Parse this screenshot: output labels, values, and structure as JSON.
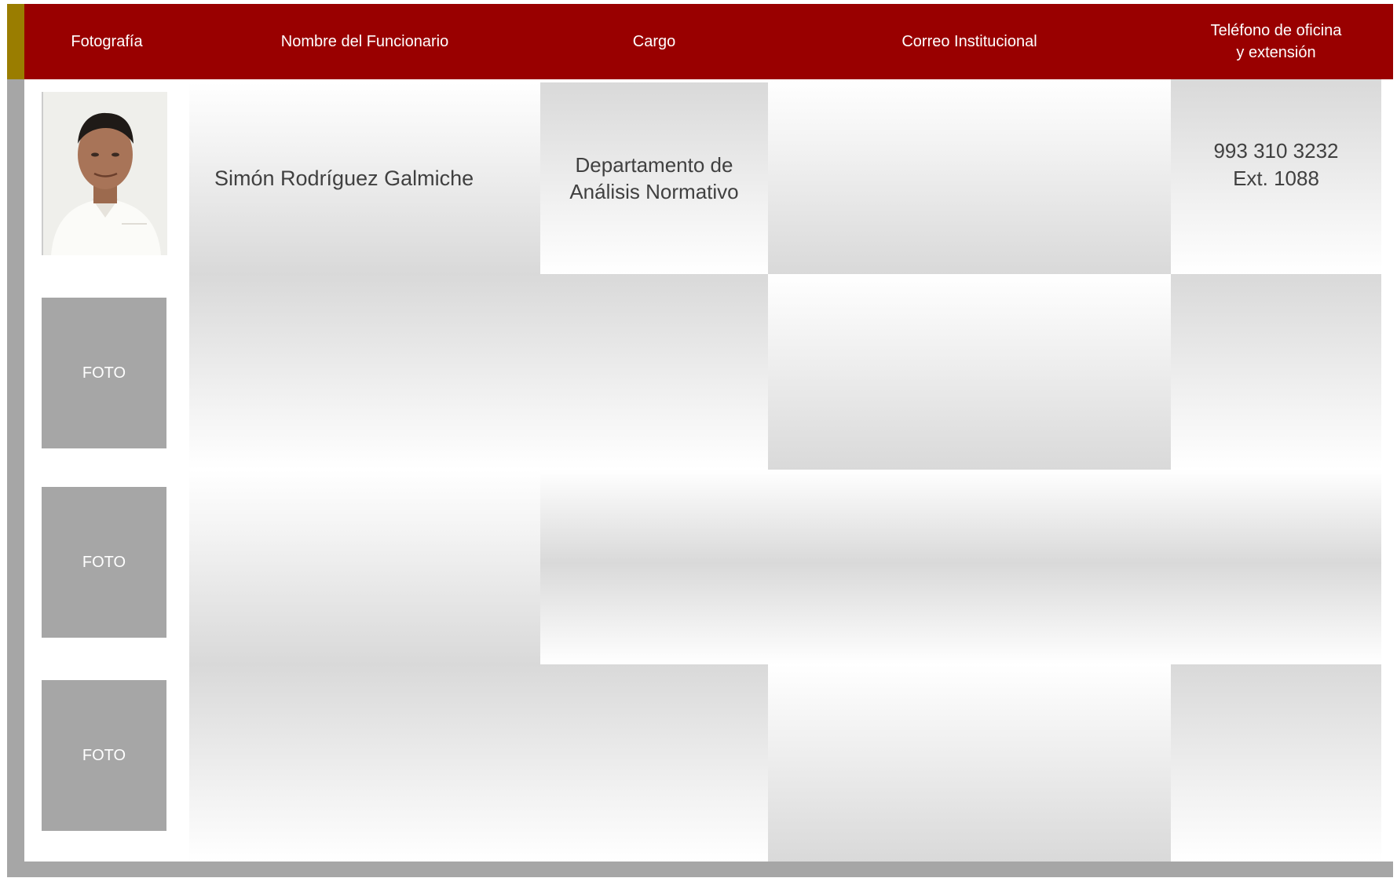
{
  "table": {
    "headers": {
      "photo": "Fotografía",
      "name": "Nombre del Funcionario",
      "position": "Cargo",
      "email": "Correo Institucional",
      "phone": "Teléfono de oficina\ny extensión"
    },
    "rows": [
      {
        "photo_label": "",
        "name": "Simón Rodríguez Galmiche",
        "position": "Departamento de\nAnálisis Normativo",
        "email": "",
        "phone": "993 310 3232\nExt. 1088"
      },
      {
        "photo_label": "FOTO",
        "name": "",
        "position": "",
        "email": "",
        "phone": ""
      },
      {
        "photo_label": "FOTO",
        "name": "",
        "position": "",
        "email": "",
        "phone": ""
      },
      {
        "photo_label": "FOTO",
        "name": "",
        "position": "",
        "email": "",
        "phone": ""
      }
    ]
  },
  "colors": {
    "header_bg": "#990000",
    "accent_gold": "#9a7d00",
    "frame_gray": "#a6a6a6",
    "placeholder_gray": "#a6a6a6"
  }
}
